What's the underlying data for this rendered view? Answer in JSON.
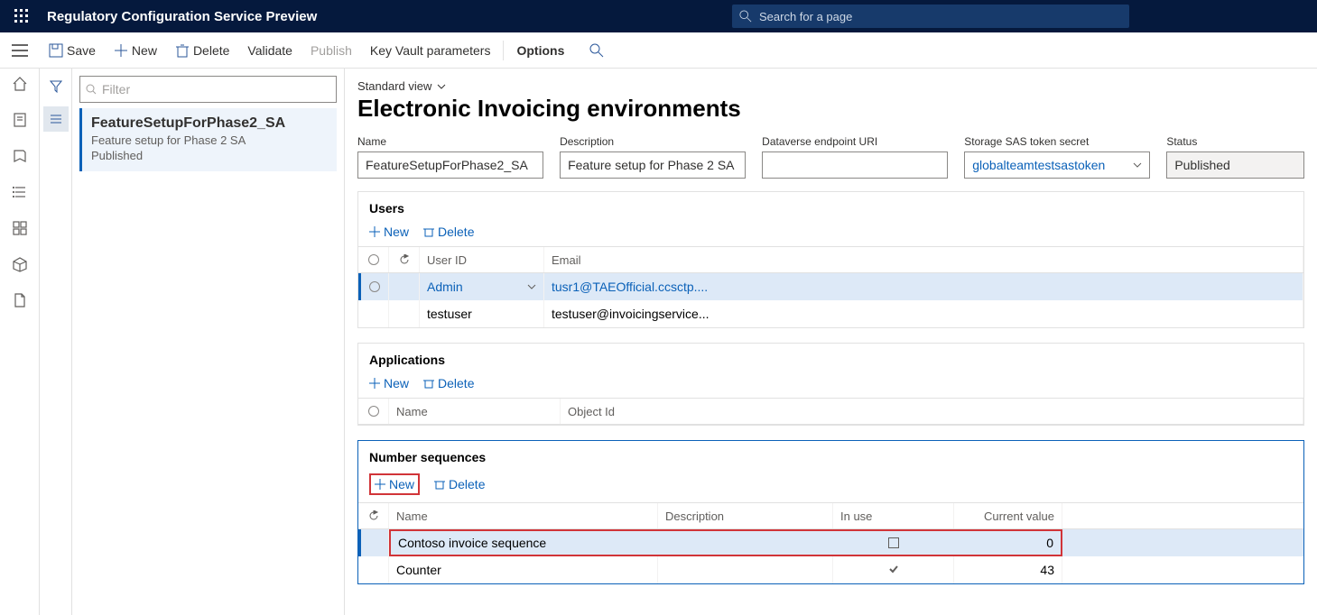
{
  "header": {
    "app_title": "Regulatory Configuration Service Preview",
    "search_placeholder": "Search for a page"
  },
  "actionbar": {
    "save": "Save",
    "new": "New",
    "delete": "Delete",
    "validate": "Validate",
    "publish": "Publish",
    "kv": "Key Vault parameters",
    "options": "Options"
  },
  "listpanel": {
    "filter_placeholder": "Filter",
    "item_title": "FeatureSetupForPhase2_SA",
    "item_sub": "Feature setup for Phase 2 SA",
    "item_state": "Published"
  },
  "main": {
    "view_label": "Standard view",
    "title": "Electronic Invoicing environments",
    "fields": {
      "name_label": "Name",
      "name_value": "FeatureSetupForPhase2_SA",
      "desc_label": "Description",
      "desc_value": "Feature setup for Phase 2 SA",
      "dv_label": "Dataverse endpoint URI",
      "dv_value": "",
      "sas_label": "Storage SAS token secret",
      "sas_value": "globalteamtestsastoken",
      "status_label": "Status",
      "status_value": "Published"
    }
  },
  "users": {
    "panel": "Users",
    "new": "New",
    "delete": "Delete",
    "h_id": "User ID",
    "h_email": "Email",
    "rows": [
      {
        "id": "Admin",
        "email": "tusr1@TAEOfficial.ccsctp...."
      },
      {
        "id": "testuser",
        "email": "testuser@invoicingservice..."
      }
    ]
  },
  "apps": {
    "panel": "Applications",
    "new": "New",
    "delete": "Delete",
    "h_name": "Name",
    "h_obj": "Object Id"
  },
  "nums": {
    "panel": "Number sequences",
    "new": "New",
    "delete": "Delete",
    "h_name": "Name",
    "h_desc": "Description",
    "h_use": "In use",
    "h_val": "Current value",
    "rows": [
      {
        "name": "Contoso invoice sequence",
        "desc": "",
        "inuse": false,
        "val": "0"
      },
      {
        "name": "Counter",
        "desc": "",
        "inuse": true,
        "val": "43"
      }
    ]
  }
}
